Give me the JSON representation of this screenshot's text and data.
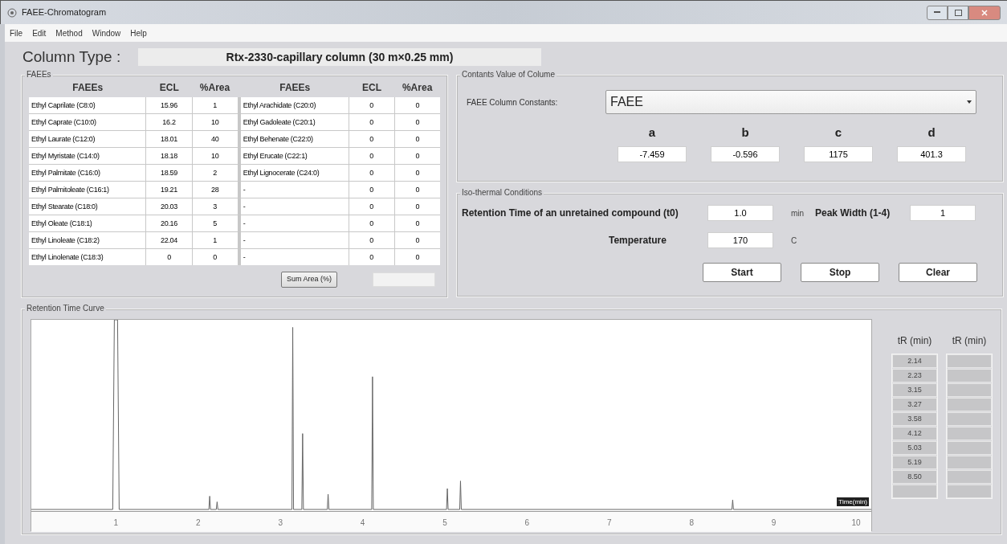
{
  "window": {
    "title": "FAEE-Chromatogram"
  },
  "menu": [
    "File",
    "Edit",
    "Method",
    "Window",
    "Help"
  ],
  "column_type": {
    "label": "Column Type :",
    "value": "Rtx-2330-capillary column (30 m×0.25 mm)"
  },
  "faees_group": {
    "title": "FAEEs",
    "columns": [
      "FAEEs",
      "ECL",
      "%Area",
      "FAEEs",
      "ECL",
      "%Area"
    ],
    "rows": [
      [
        "Ethyl Caprilate (C8:0)",
        "15.96",
        "1",
        "Ethyl Arachidate (C20:0)",
        "0",
        "0"
      ],
      [
        "Ethyl Caprate (C10:0)",
        "16.2",
        "10",
        "Ethyl Gadoleate (C20:1)",
        "0",
        "0"
      ],
      [
        "Ethyl Laurate (C12:0)",
        "18.01",
        "40",
        "Ethyl Behenate (C22:0)",
        "0",
        "0"
      ],
      [
        "Ethyl Myristate (C14:0)",
        "18.18",
        "10",
        "Ethyl Erucate (C22:1)",
        "0",
        "0"
      ],
      [
        "Ethyl Palmitate (C16:0)",
        "18.59",
        "2",
        "Ethyl Lignocerate (C24:0)",
        "0",
        "0"
      ],
      [
        "Ethyl Palmitoleate (C16:1)",
        "19.21",
        "28",
        "-",
        "0",
        "0"
      ],
      [
        "Ethyl Stearate (C18:0)",
        "20.03",
        "3",
        "-",
        "0",
        "0"
      ],
      [
        "Ethyl Oleate (C18:1)",
        "20.16",
        "5",
        "-",
        "0",
        "0"
      ],
      [
        "Ethyl Linoleate (C18:2)",
        "22.04",
        "1",
        "-",
        "0",
        "0"
      ],
      [
        "Ethyl Linolenate (C18:3)",
        "0",
        "0",
        "-",
        "0",
        "0"
      ]
    ],
    "sum_button": "Sum Area (%)"
  },
  "constants_group": {
    "title": "Contants Value of Colume",
    "combo_label": "FAEE Column Constants:",
    "combo_value": "FAEE",
    "constants": [
      {
        "label": "a",
        "value": "-7.459"
      },
      {
        "label": "b",
        "value": "-0.596"
      },
      {
        "label": "c",
        "value": "1175"
      },
      {
        "label": "d",
        "value": "401.3"
      }
    ]
  },
  "isothermal_group": {
    "title": "Iso-thermal Conditions",
    "t0_label": "Retention Time of an unretained compound (t0)",
    "t0_value": "1.0",
    "t0_unit": "min",
    "peak_width_label": "Peak Width (1-4)",
    "peak_width_value": "1",
    "temperature_label": "Temperature",
    "temperature_value": "170",
    "temperature_unit": "C",
    "buttons": [
      "Start",
      "Stop",
      "Clear"
    ]
  },
  "retention_group": {
    "title": "Retention Time Curve",
    "x_label": "Time(min)",
    "x_ticks": [
      "1",
      "2",
      "3",
      "4",
      "5",
      "6",
      "7",
      "8",
      "9",
      "10"
    ],
    "tr_columns": [
      {
        "header": "tR (min)",
        "values": [
          "2.14",
          "2.23",
          "3.15",
          "3.27",
          "3.58",
          "4.12",
          "5.03",
          "5.19",
          "8.50"
        ]
      },
      {
        "header": "tR (min)"
      }
    ]
  }
}
